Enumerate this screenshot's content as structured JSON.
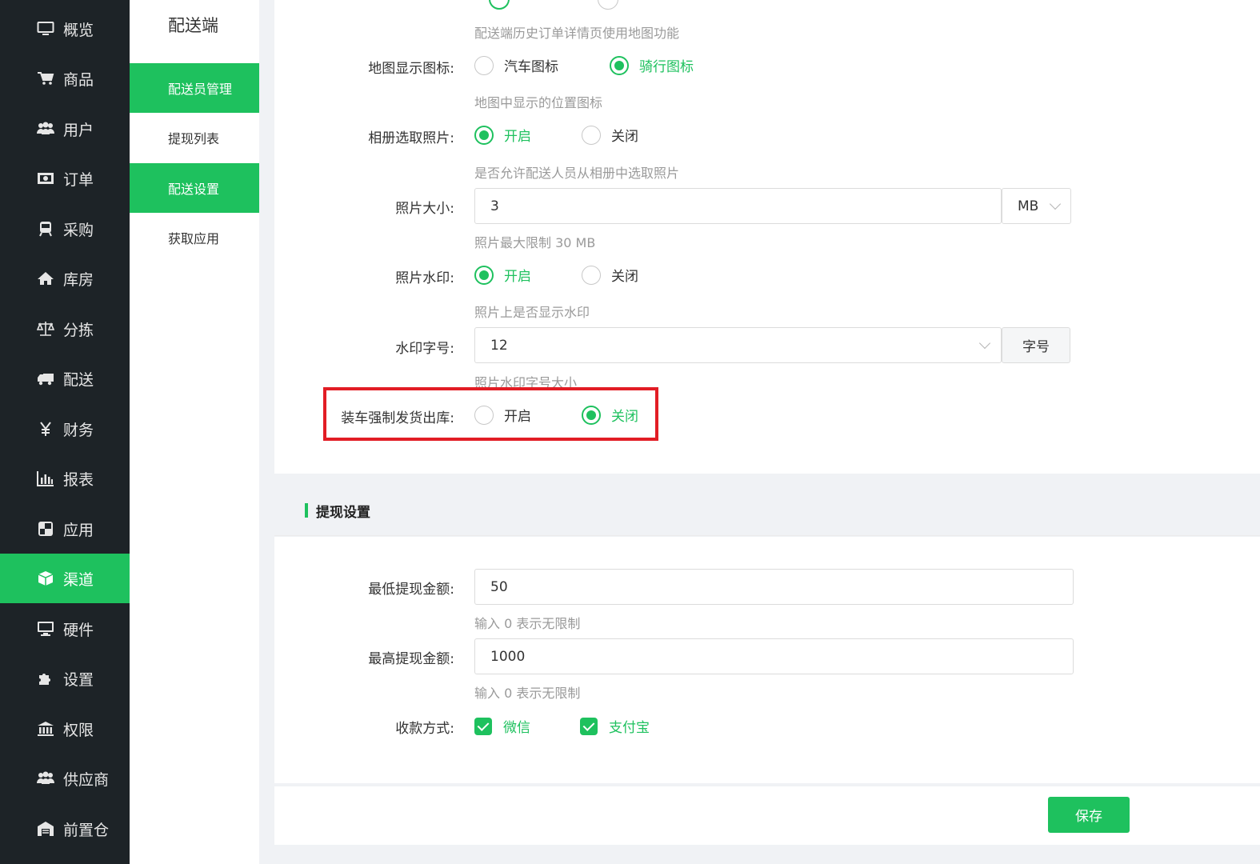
{
  "sidebar": {
    "items": [
      {
        "label": "概览",
        "icon": "monitor-icon"
      },
      {
        "label": "商品",
        "icon": "cart-icon"
      },
      {
        "label": "用户",
        "icon": "users-icon"
      },
      {
        "label": "订单",
        "icon": "money-icon"
      },
      {
        "label": "采购",
        "icon": "train-icon"
      },
      {
        "label": "库房",
        "icon": "home-icon"
      },
      {
        "label": "分拣",
        "icon": "balance-icon"
      },
      {
        "label": "配送",
        "icon": "truck-icon"
      },
      {
        "label": "财务",
        "icon": "yen-icon"
      },
      {
        "label": "报表",
        "icon": "bar-chart-icon"
      },
      {
        "label": "应用",
        "icon": "app-icon"
      },
      {
        "label": "渠道",
        "icon": "cube-icon"
      },
      {
        "label": "硬件",
        "icon": "desktop-icon"
      },
      {
        "label": "设置",
        "icon": "puzzle-icon"
      },
      {
        "label": "权限",
        "icon": "bank-icon"
      },
      {
        "label": "供应商",
        "icon": "users-icon"
      },
      {
        "label": "前置仓",
        "icon": "warehouse-icon"
      }
    ],
    "active_index": 11
  },
  "submenu": {
    "title": "配送端",
    "items": [
      "配送员管理",
      "提现列表",
      "配送设置",
      "获取应用"
    ]
  },
  "delivery_settings": {
    "history_map_hint": "配送端历史订单详情页使用地图功能",
    "map_icon": {
      "label": "地图显示图标:",
      "options": [
        "汽车图标",
        "骑行图标"
      ],
      "selected": "骑行图标",
      "hint": "地图中显示的位置图标"
    },
    "album_photo": {
      "label": "相册选取照片:",
      "options": [
        "开启",
        "关闭"
      ],
      "selected": "开启",
      "hint": "是否允许配送人员从相册中选取照片"
    },
    "photo_size": {
      "label": "照片大小:",
      "value": "3",
      "unit": "MB",
      "hint": "照片最大限制 30 MB"
    },
    "photo_watermark": {
      "label": "照片水印:",
      "options": [
        "开启",
        "关闭"
      ],
      "selected": "开启",
      "hint": "照片上是否显示水印"
    },
    "watermark_font": {
      "label": "水印字号:",
      "value": "12",
      "addon": "字号",
      "hint": "照片水印字号大小"
    },
    "force_ship": {
      "label": "装车强制发货出库:",
      "options": [
        "开启",
        "关闭"
      ],
      "selected": "关闭"
    }
  },
  "withdraw_settings": {
    "title": "提现设置",
    "min_amount": {
      "label": "最低提现金额:",
      "value": "50",
      "hint": "输入 0 表示无限制"
    },
    "max_amount": {
      "label": "最高提现金额:",
      "value": "1000",
      "hint": "输入 0 表示无限制"
    },
    "payment": {
      "label": "收款方式:",
      "options": [
        "微信",
        "支付宝"
      ]
    }
  },
  "actions": {
    "save": "保存"
  },
  "colors": {
    "accent": "#1ec15e",
    "sidebar_bg": "#1d2327",
    "highlight": "#e21d25"
  }
}
